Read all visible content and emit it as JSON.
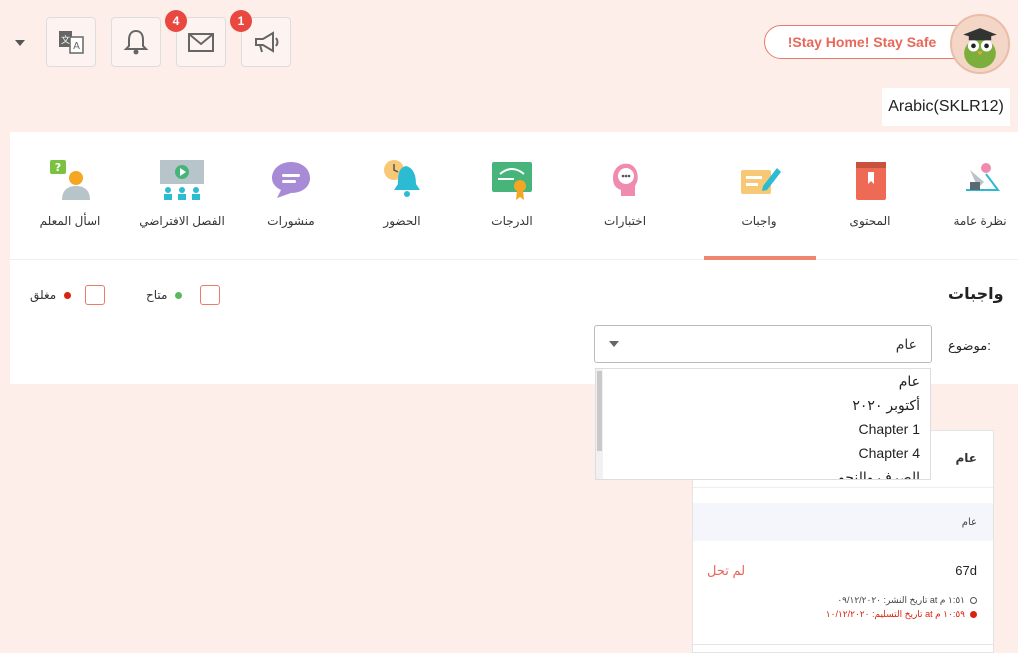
{
  "header": {
    "badges": {
      "messages": "4",
      "announcements": "1"
    },
    "stay_home": "!Stay Home! Stay Safe",
    "course": "Arabic(SKLR12)"
  },
  "tabs": [
    {
      "label": "نظرة عامة",
      "icon": "overview-icon"
    },
    {
      "label": "المحتوى",
      "icon": "book-icon"
    },
    {
      "label": "واجبات",
      "icon": "assignment-icon",
      "active": true
    },
    {
      "label": "اختبارات",
      "icon": "quiz-icon"
    },
    {
      "label": "الدرجات",
      "icon": "certificate-icon"
    },
    {
      "label": "الحضور",
      "icon": "bell-clock-icon"
    },
    {
      "label": "منشورات",
      "icon": "chat-icon"
    },
    {
      "label": "الفصل الافتراضي",
      "icon": "virtual-class-icon"
    },
    {
      "label": "اسأل المعلم",
      "icon": "ask-teacher-icon"
    }
  ],
  "section_title": "واجبات",
  "legend": {
    "available": "متاح",
    "closed": "مغلق"
  },
  "topic_label": "موضوع:",
  "topic_selected": "عام",
  "topic_options": [
    "عام",
    "أكتوبر ٢٠٢٠",
    "Chapter 1",
    "Chapter 4",
    "الصرف والنحو"
  ],
  "panel": {
    "title": "عام",
    "sub": "عام",
    "due": "67d",
    "state": "لم تحل",
    "published": "تاريخ النشر: ٠٩/١٢/٢٠٢٠ at ١:٥١ م",
    "delivery": "تاريخ التسليم: ١٠/١٢/٢٠٢٠ at ١٠:٥٩ م"
  },
  "colors": {
    "accent": "#e8675a",
    "available": "#5cb85c",
    "closed": "#d9230f",
    "background": "#fdeeea"
  }
}
